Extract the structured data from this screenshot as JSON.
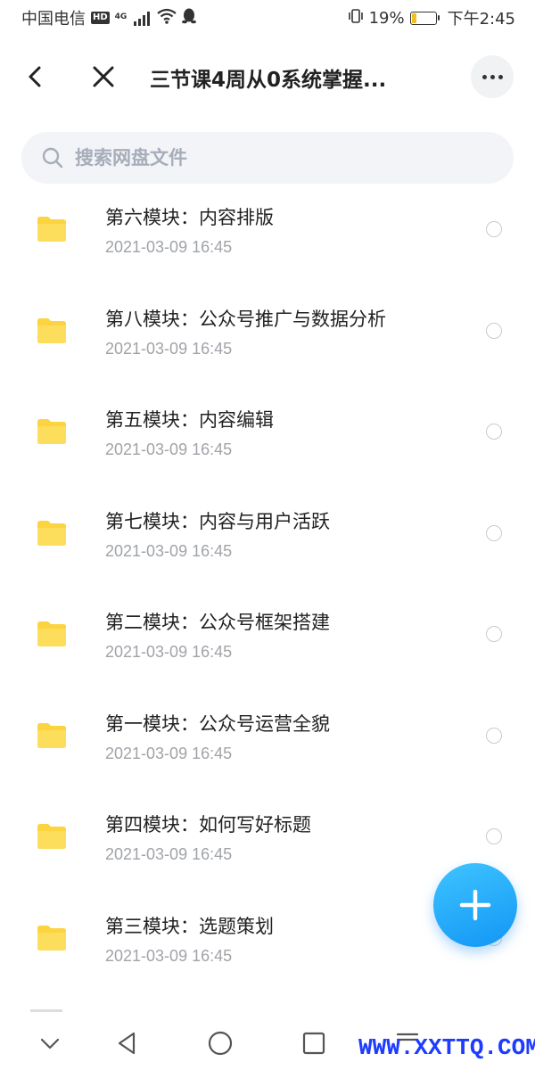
{
  "status_bar": {
    "carrier": "中国电信",
    "hd_label": "HD",
    "network_label": "4G",
    "battery_percent_text": "19%",
    "battery_level": 0.19,
    "time": "下午2:45"
  },
  "header": {
    "title": "三节课4周从0系统掌握...",
    "icons": {
      "back": "back-arrow-icon",
      "close": "close-icon",
      "more": "more-horizontal-icon"
    }
  },
  "search": {
    "placeholder": "搜索网盘文件",
    "value": ""
  },
  "files": [
    {
      "name": "第六模块：内容排版",
      "date": "2021-03-09  16:45"
    },
    {
      "name": "第八模块：公众号推广与数据分析",
      "date": "2021-03-09  16:45"
    },
    {
      "name": "第五模块：内容编辑",
      "date": "2021-03-09  16:45"
    },
    {
      "name": "第七模块：内容与用户活跃",
      "date": "2021-03-09  16:45"
    },
    {
      "name": "第二模块：公众号框架搭建",
      "date": "2021-03-09  16:45"
    },
    {
      "name": "第一模块：公众号运营全貌",
      "date": "2021-03-09  16:45"
    },
    {
      "name": "第四模块：如何写好标题",
      "date": "2021-03-09  16:45"
    },
    {
      "name": "第三模块：选题策划",
      "date": "2021-03-09  16:45"
    }
  ],
  "colors": {
    "folder": "#fcd440",
    "fab_start": "#3fc4ff",
    "fab_end": "#1296f5",
    "watermark": "#1d3cff"
  },
  "watermark": "WWW.XXTTQ.COM"
}
